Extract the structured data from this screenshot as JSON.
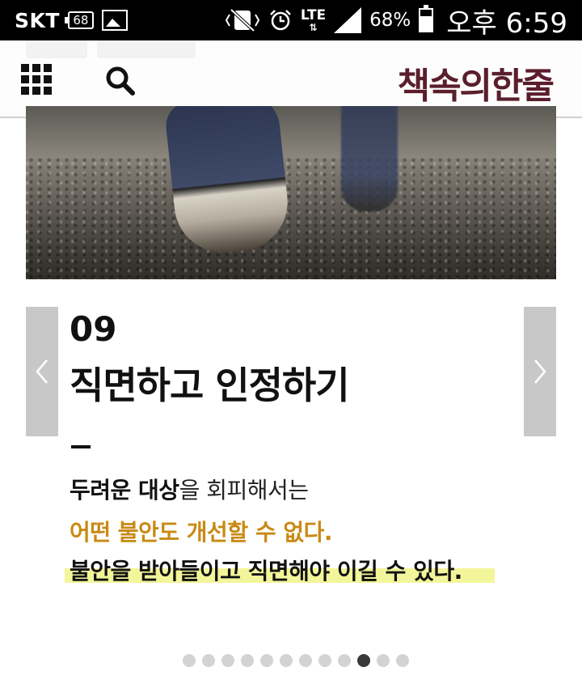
{
  "status_bar": {
    "carrier": "SKT",
    "notification_count": "68",
    "network": "LTE",
    "battery_percent": "68%",
    "battery_level": 0.68,
    "time": "오후 6:59",
    "icons": [
      "gallery-icon",
      "mute-vibrate-icon",
      "alarm-icon",
      "signal-icon",
      "battery-icon"
    ]
  },
  "header": {
    "menu_icon": "grid-menu-icon",
    "search_icon": "search-icon",
    "brand": "책속의한줄",
    "brand_color": "#5b1e2c"
  },
  "slide": {
    "number": "09",
    "title": "직면하고 인정하기",
    "line1_bold": "두려운 대상",
    "line1_rest": "을 회피해서는",
    "line2": "어떤 불안도 개선할 수 없다.",
    "line3": "불안을 받아들이고 직면해야 이길 수 있다.",
    "accent_color": "#c98a14",
    "highlight_color": "#f3f59a"
  },
  "pager": {
    "total": 12,
    "active_index": 9
  }
}
